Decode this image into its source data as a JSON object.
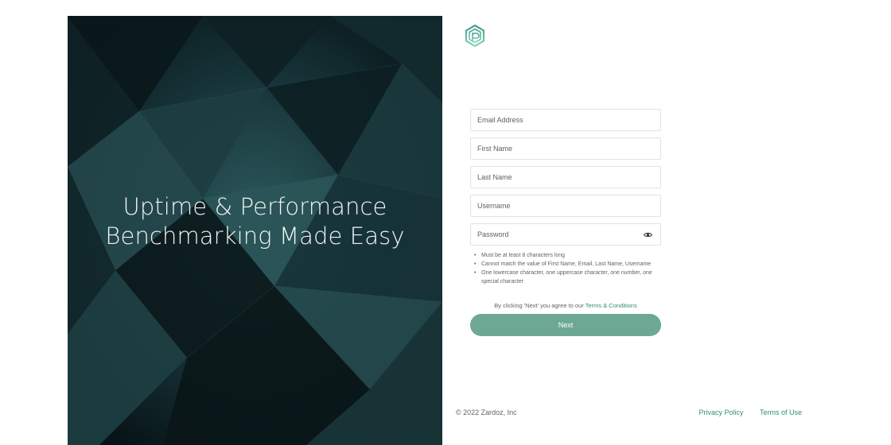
{
  "hero": {
    "title_line1": "Uptime & Performance",
    "title_line2": "Benchmarking Made Easy"
  },
  "logo": {
    "icon": "hexagon-logo-icon"
  },
  "form": {
    "email_placeholder": "Email Address",
    "first_name_placeholder": "First Name",
    "last_name_placeholder": "Last Name",
    "username_placeholder": "Username",
    "password_placeholder": "Password",
    "password_toggle_icon": "eye-icon",
    "rules": [
      "Must be at least 8 characters long",
      "Cannot match the value of First Name, Email, Last Name, Username",
      "One lowercase character, one uppercase character, one number, one special character"
    ],
    "agree_text": "By clicking 'Next' you agree to our ",
    "terms_link": "Terms & Conditions",
    "next_label": "Next"
  },
  "footer": {
    "copyright": "© 2022  Zardoz, Inc",
    "privacy": "Privacy Policy",
    "terms": "Terms of Use"
  },
  "colors": {
    "accent": "#2f8f7a",
    "button": "#6da895",
    "hero_bg": "#0d2327"
  }
}
